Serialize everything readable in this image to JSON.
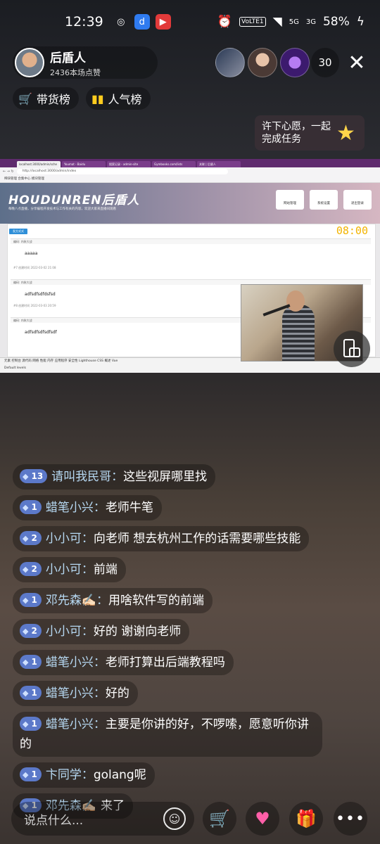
{
  "status_bar": {
    "time": "12:39",
    "battery": "58%",
    "network_5g": "5G",
    "network_3g": "3G",
    "volte": "VoLTE1"
  },
  "host": {
    "name": "后盾人",
    "likes": "2436本场点赞"
  },
  "viewer_count": "30",
  "ranks": {
    "goods": "带货榜",
    "popular": "人气榜"
  },
  "wish": {
    "text": "许下心愿，一起完成任务"
  },
  "screen_share": {
    "browser_tabs": [
      "localhost:3000/admin/sche",
      "Youmat - Baidu",
      "搜索记录 - admin-site",
      "Gymbooks.com/lists",
      "关联 | 后盾人"
    ],
    "url": "http://localhost:3000/admin/index",
    "bookmarks": "稀缺管理  合集中心  模块管理",
    "site_logo": "HOUDUNREN后盾人",
    "site_subtitle": "每晚八点直播，分享编程开发技术与工作有关的内容，欢迎大家来直播间观看",
    "site_buttons": [
      "网站管理",
      "系统设置",
      "退出登录"
    ],
    "post_button": "发方式式",
    "clock": "08:00",
    "posts": [
      {
        "head": "编码: 内装大战",
        "title": "aaaaa",
        "meta": "#7 创建时间 2022-03-02 21:08"
      },
      {
        "head": "编码: 内装大战",
        "title": "adfsdfsdfdsfsd",
        "meta": "#8 创建时间 2022-03-03 20:59"
      },
      {
        "head": "编码: 内装大战",
        "title": "adfsdfsdfsdfsdf",
        "meta": ""
      }
    ],
    "devtools_tabs": "元素  控制台  源代码  网络  性能  内存  应用程序  安全性  Lighthouse  CSS 概述  Vue",
    "devtools_filter": "Default levels"
  },
  "chat": [
    {
      "level": "13",
      "user": "请叫我民哥",
      "text": "这些视屏哪里找"
    },
    {
      "level": "1",
      "user": "蜡笔小兴",
      "text": "老师牛笔"
    },
    {
      "level": "2",
      "user": "小小可",
      "text": "向老师 想去杭州工作的话需要哪些技能"
    },
    {
      "level": "2",
      "user": "小小可",
      "text": "前端"
    },
    {
      "level": "1",
      "user": "邓先森✍🏻",
      "text": "用啥软件写的前端"
    },
    {
      "level": "2",
      "user": "小小可",
      "text": "好的 谢谢向老师"
    },
    {
      "level": "1",
      "user": "蜡笔小兴",
      "text": "老师打算出后端教程吗"
    },
    {
      "level": "1",
      "user": "蜡笔小兴",
      "text": "好的"
    },
    {
      "level": "1",
      "user": "蜡笔小兴",
      "text": "主要是你讲的好，不啰嗦，愿意听你讲的"
    },
    {
      "level": "1",
      "user": "卞同学",
      "text": "golang呢"
    },
    {
      "level": "1",
      "user": "邓先森✍🏻",
      "text": "来了"
    }
  ],
  "input": {
    "placeholder": "说点什么..."
  }
}
